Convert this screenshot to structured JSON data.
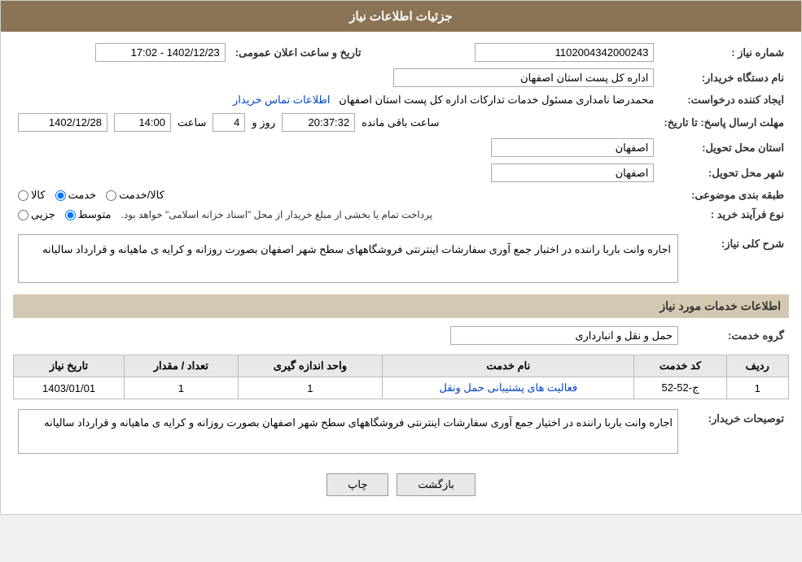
{
  "header": {
    "title": "جزئیات اطلاعات نیاز"
  },
  "fields": {
    "shomara_niaz_label": "شماره نیاز :",
    "shomara_niaz_value": "1102004342000243",
    "nam_dastgah_label": "نام دستگاه خریدار:",
    "nam_dastgah_value": "اداره کل پست استان اصفهان",
    "ijad_konande_label": "ایجاد کننده درخواست:",
    "ijad_konande_value": "محمدرضا نامداری مسئول خدمات تداركات اداره كل پست استان اصفهان",
    "ijad_konande_link": "اطلاعات تماس خریدار",
    "mohlet_label": "مهلت ارسال پاسخ: تا تاریخ:",
    "tarikh_value": "1402/12/28",
    "saat_label": "ساعت",
    "saat_value": "14:00",
    "rooz_label": "روز و",
    "rooz_value": "4",
    "baqi_saat_label": "ساعت باقی مانده",
    "baqi_saat_value": "20:37:32",
    "tarikh_aalan_label": "تاریخ و ساعت اعلان عمومی:",
    "tarikh_aalan_value": "1402/12/23 - 17:02",
    "ostan_tahvil_label": "استان محل تحویل:",
    "ostan_tahvil_value": "اصفهان",
    "shahr_tahvil_label": "شهر محل تحویل:",
    "shahr_tahvil_value": "اصفهان",
    "tabaqebandi_label": "طبقه بندی موضوعی:",
    "tabaqebandi_kala": "کالا",
    "tabaqebandi_khadamat": "خدمت",
    "tabaqebandi_kala_khadamat": "کالا/خدمت",
    "tabaqebandi_selected": "khadamat",
    "noafrayand_label": "نوع فرآیند خرید :",
    "noafrayand_jozvi": "جزیی",
    "noafrayand_motoset": "متوسط",
    "noafrayand_notice": "پرداخت تمام یا بخشی از مبلغ خریدار از محل \"اسناد خزانه اسلامی\" خواهد بود.",
    "noafrayand_selected": "motoset"
  },
  "sharh_section": {
    "title": "شرح کلی نیاز:",
    "text": "اجاره وانت باربا راننده در اختیار جمع آوری سفارشات اینترنتی فروشگاههای سطح شهر اصفهان بصورت روزانه و کرایه ی ماهیانه و قرارداد سالیانه"
  },
  "khadamat_section": {
    "title": "اطلاعات خدمات مورد نیاز",
    "group_label": "گروه خدمت:",
    "group_value": "حمل و نقل و انبارداری",
    "table": {
      "headers": [
        "ردیف",
        "کد خدمت",
        "نام خدمت",
        "واحد اندازه گیری",
        "تعداد / مقدار",
        "تاریخ نیاز"
      ],
      "rows": [
        {
          "radif": "1",
          "code": "ج-52-52",
          "name": "فعالیت های پشتیبانی حمل ونقل",
          "vahed": "1",
          "tedad": "1",
          "tarikh": "1403/01/01"
        }
      ]
    }
  },
  "tosifat_section": {
    "label": "توصیحات خریدار:",
    "text": "اجاره وانت باربا راننده در اختیار جمع آوری سفارشات اینترنتی فروشگاههای سطح شهر اصفهان بصورت روزانه و کرایه ی ماهیانه و قرارداد سالیانه"
  },
  "buttons": {
    "print": "چاپ",
    "back": "بازگشت"
  }
}
